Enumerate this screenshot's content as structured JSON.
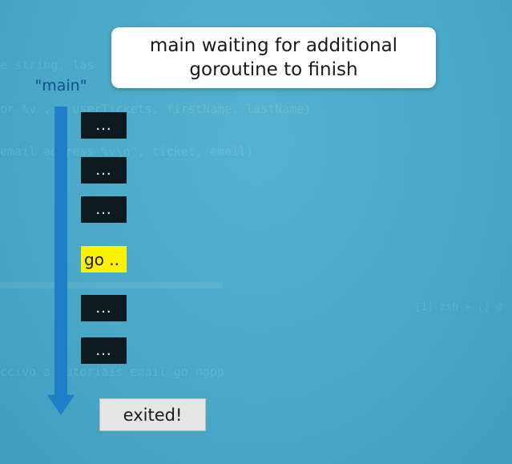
{
  "callout": {
    "line1": "main waiting for additional",
    "line2": "goroutine to finish"
  },
  "lane": {
    "label": "\"main\""
  },
  "steps": [
    {
      "label": "..."
    },
    {
      "label": "..."
    },
    {
      "label": "..."
    },
    {
      "label": "go .."
    },
    {
      "label": "..."
    },
    {
      "label": "..."
    }
  ],
  "exit": {
    "label": "exited!"
  },
  "colors": {
    "background": "#4aa9c8",
    "arrow": "#1e7ec8",
    "step_block": "#0d1a1f",
    "go_highlight": "#fff200",
    "lane_label": "#0f4f86"
  }
}
